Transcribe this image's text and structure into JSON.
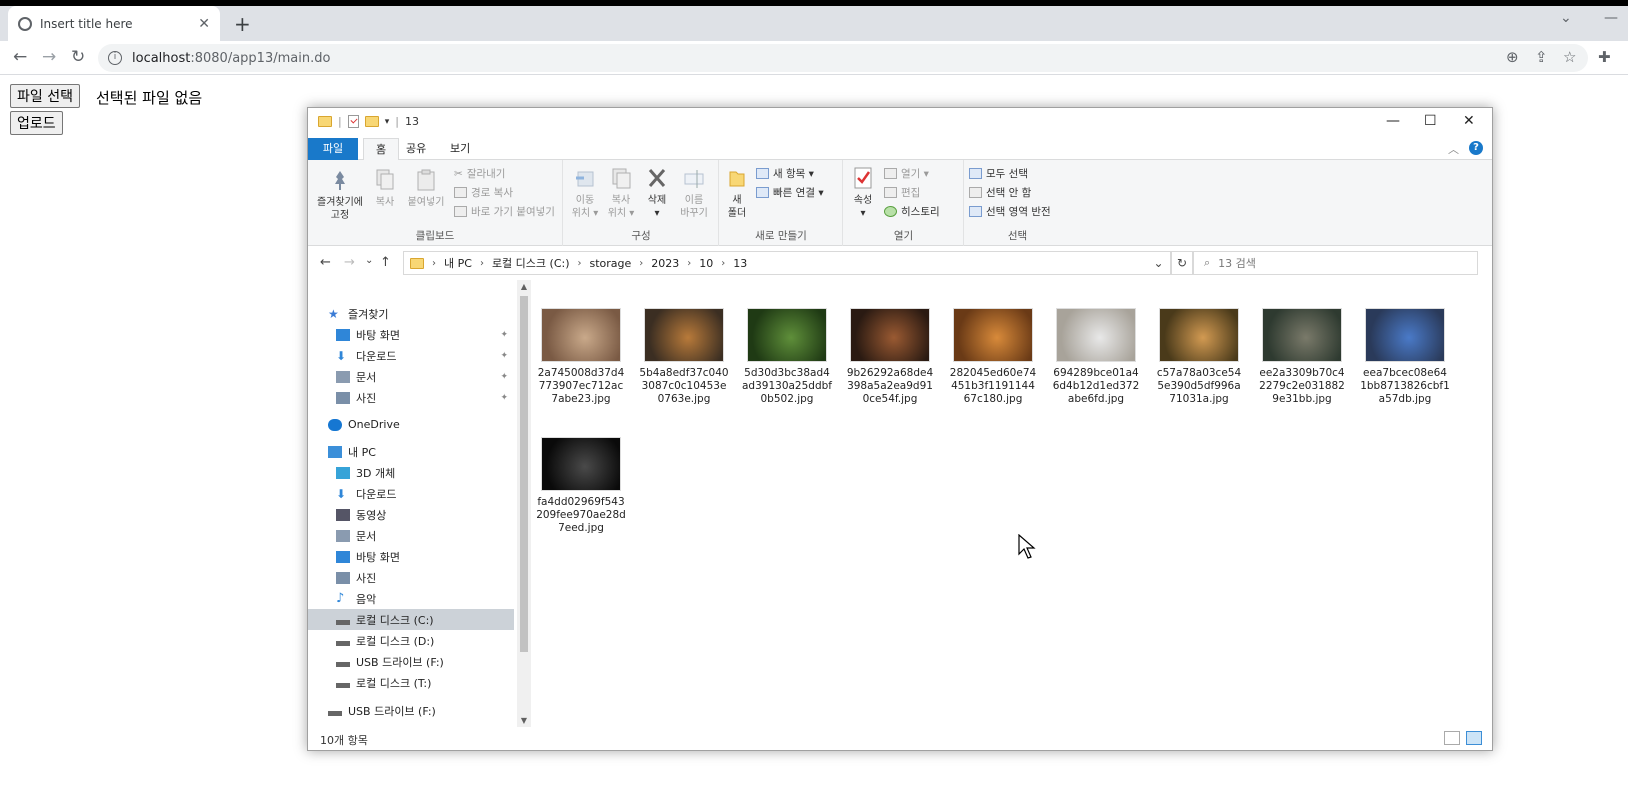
{
  "browser": {
    "tab_title": "Insert title here",
    "tab_close": "✕",
    "new_tab": "+",
    "back": "←",
    "forward": "→",
    "reload": "↻",
    "url_host": "localhost",
    "url_rest": ":8080/app13/main.do",
    "info_icon": "i",
    "zoom_icon": "⊕",
    "share_icon": "⇪",
    "star_icon": "☆",
    "ext_icon": "✚",
    "collapse": "⌄",
    "minimize": "—"
  },
  "page": {
    "file_button": "파일 선택",
    "file_status": "선택된 파일 없음",
    "upload_button": "업로드"
  },
  "explorer": {
    "qa_sep": "|",
    "qa_arrow": "▾",
    "window_title": "13",
    "controls": {
      "minimize": "—",
      "maximize": "☐",
      "close": "✕"
    },
    "ribbon_tabs": {
      "file": "파일",
      "home": "홈",
      "share": "공유",
      "view": "보기"
    },
    "ribbon_collapse": "︿",
    "help": "?",
    "clipboard": {
      "pin": [
        "즐겨찾기에",
        "고정"
      ],
      "copy": "복사",
      "paste": "붙여넣기",
      "cut": "잘라내기",
      "copy_path": "경로 복사",
      "paste_shortcut": "바로 가기 붙여넣기",
      "label": "클립보드"
    },
    "organize": {
      "move": [
        "이동",
        "위치 ▾"
      ],
      "copyto": [
        "복사",
        "위치 ▾"
      ],
      "delete": [
        "삭제",
        "▾"
      ],
      "rename": [
        "이름",
        "바꾸기"
      ],
      "label": "구성"
    },
    "new": {
      "folder": [
        "새",
        "폴더"
      ],
      "new_item": "새 항목 ▾",
      "easy_access": "빠른 연결 ▾",
      "label": "새로 만들기"
    },
    "open": {
      "properties": [
        "속성",
        "▾"
      ],
      "open": "열기 ▾",
      "edit": "편집",
      "history": "히스토리",
      "label": "열기"
    },
    "select": {
      "all": "모두 선택",
      "none": "선택 안 함",
      "invert": "선택 영역 반전",
      "label": "선택"
    },
    "nav": {
      "back": "←",
      "forward": "→",
      "recent": "⌄",
      "up": "↑"
    },
    "address": {
      "chevron": "›",
      "crumbs": [
        "내 PC",
        "로컬 디스크 (C:)",
        "storage",
        "2023",
        "10",
        "13"
      ],
      "dropdown": "⌄",
      "refresh": "↻"
    },
    "search_icon": "⌕",
    "search_placeholder": "13 검색",
    "scroll_up": "▲",
    "scroll_down": "▼",
    "pin_mark": "✦",
    "nav_pane": [
      {
        "label": "즐겨찾기",
        "icon": "star-icon",
        "color": "#3a7bd5",
        "indent": 1,
        "pin": false
      },
      {
        "label": "바탕 화면",
        "icon": "desktop-icon",
        "color": "#2f86d8",
        "indent": 2,
        "pin": true
      },
      {
        "label": "다운로드",
        "icon": "download-icon",
        "color": "#2f86d8",
        "indent": 2,
        "pin": true
      },
      {
        "label": "문서",
        "icon": "document-icon",
        "color": "#8a9bb0",
        "indent": 2,
        "pin": true
      },
      {
        "label": "사진",
        "icon": "pictures-icon",
        "color": "#7a8fa8",
        "indent": 2,
        "pin": true
      },
      {
        "label": "OneDrive",
        "icon": "cloud-icon",
        "color": "#1677d2",
        "indent": 1,
        "pin": false
      },
      {
        "label": "내 PC",
        "icon": "computer-icon",
        "color": "#3b8fd9",
        "indent": 1,
        "pin": false
      },
      {
        "label": "3D 개체",
        "icon": "cube-icon",
        "color": "#36a3d8",
        "indent": 2,
        "pin": false
      },
      {
        "label": "다운로드",
        "icon": "download-icon",
        "color": "#2f86d8",
        "indent": 2,
        "pin": false
      },
      {
        "label": "동영상",
        "icon": "video-icon",
        "color": "#556",
        "indent": 2,
        "pin": false
      },
      {
        "label": "문서",
        "icon": "document-icon",
        "color": "#8a9bb0",
        "indent": 2,
        "pin": false
      },
      {
        "label": "바탕 화면",
        "icon": "desktop-icon",
        "color": "#2f86d8",
        "indent": 2,
        "pin": false
      },
      {
        "label": "사진",
        "icon": "pictures-icon",
        "color": "#7a8fa8",
        "indent": 2,
        "pin": false
      },
      {
        "label": "음악",
        "icon": "music-icon",
        "color": "#2f86d8",
        "indent": 2,
        "pin": false
      },
      {
        "label": "로컬 디스크 (C:)",
        "icon": "drive-icon",
        "color": "#666",
        "indent": 2,
        "pin": false,
        "selected": true
      },
      {
        "label": "로컬 디스크 (D:)",
        "icon": "drive-icon",
        "color": "#666",
        "indent": 2,
        "pin": false
      },
      {
        "label": "USB 드라이브 (F:)",
        "icon": "usb-drive-icon",
        "color": "#666",
        "indent": 2,
        "pin": false
      },
      {
        "label": "로컬 디스크 (T:)",
        "icon": "drive-icon",
        "color": "#666",
        "indent": 2,
        "pin": false
      },
      {
        "label": "USB 드라이브 (F:)",
        "icon": "usb-drive-icon",
        "color": "#666",
        "indent": 1,
        "pin": false
      }
    ],
    "files": [
      {
        "name": "2a745008d37d4773907ec712ac7abe23.jpg",
        "thumb": "cat",
        "c1": "#c9a98a",
        "c2": "#7a5a44"
      },
      {
        "name": "5b4a8edf37c0403087c0c10453e0763e.jpg",
        "thumb": "tiger",
        "c1": "#b87a3a",
        "c2": "#3b2e22"
      },
      {
        "name": "5d30d3bc38ad4ad39130a25ddbf0b502.jpg",
        "thumb": "frog",
        "c1": "#5f8f3a",
        "c2": "#1f3a14"
      },
      {
        "name": "9b26292a68de4398a5a2ea9d910ce54f.jpg",
        "thumb": "dog",
        "c1": "#9a5a32",
        "c2": "#2a1a12"
      },
      {
        "name": "282045ed60e74451b3f119114467c180.jpg",
        "thumb": "fox",
        "c1": "#d88a3a",
        "c2": "#6a3a16"
      },
      {
        "name": "694289bce01a46d4b12d1ed372abe6fd.jpg",
        "thumb": "hedgehog",
        "c1": "#e8e8e8",
        "c2": "#a8a39a"
      },
      {
        "name": "c57a78a03ce545e390d5df996a71031a.jpg",
        "thumb": "giraffe",
        "c1": "#d29a52",
        "c2": "#4a3a1a"
      },
      {
        "name": "ee2a3309b70c42279c2e0318829e31bb.jpg",
        "thumb": "deer",
        "c1": "#7a7a6a",
        "c2": "#2e3a30"
      },
      {
        "name": "eea7bcec08e641bb8713826cbf1a57db.jpg",
        "thumb": "eagle",
        "c1": "#4a7ac8",
        "c2": "#2a3a5a"
      },
      {
        "name": "fa4dd02969f543209fee970ae28d7eed.jpg",
        "thumb": "lion",
        "c1": "#4a4a4a",
        "c2": "#0a0a0a"
      }
    ],
    "status_count": "10개 항목"
  }
}
